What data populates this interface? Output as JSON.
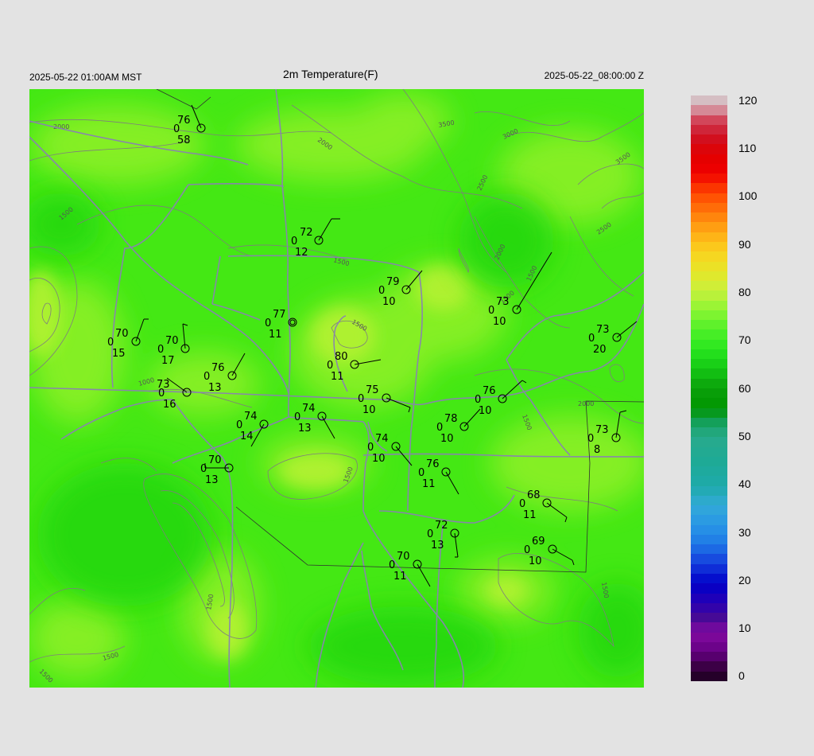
{
  "header": {
    "local_time": "2025-05-22 01:00AM MST",
    "title": "2m Temperature(F)",
    "utc_time": "2025-05-22_08:00:00 Z"
  },
  "colorbar": {
    "ticks": [
      "120",
      "110",
      "100",
      "90",
      "80",
      "70",
      "60",
      "50",
      "40",
      "30",
      "20",
      "10",
      "0"
    ]
  },
  "contour_labels": [
    "2000",
    "2000",
    "3500",
    "3000",
    "3500",
    "2500",
    "2500",
    "2000",
    "1500",
    "1500",
    "1500",
    "1000",
    "1500",
    "1500",
    "2000",
    "1500",
    "1500",
    "1500",
    "1500",
    "1500",
    "1500"
  ],
  "stations": [
    {
      "temp": "76",
      "dew": "0",
      "vis": "58"
    },
    {
      "temp": "72",
      "dew": "0",
      "vis": "12"
    },
    {
      "temp": "79",
      "dew": "0",
      "vis": "10"
    },
    {
      "temp": "73",
      "dew": "0",
      "vis": "10"
    },
    {
      "temp": "77",
      "dew": "0",
      "vis": "11"
    },
    {
      "temp": "70",
      "dew": "0",
      "vis": "15"
    },
    {
      "temp": "70",
      "dew": "0",
      "vis": "17"
    },
    {
      "temp": "80",
      "dew": "0",
      "vis": "11"
    },
    {
      "temp": "73",
      "dew": "0",
      "vis": "20"
    },
    {
      "temp": "76",
      "dew": "0",
      "vis": "13"
    },
    {
      "temp": "73",
      "dew": "0",
      "vis": "16"
    },
    {
      "temp": "75",
      "dew": "0",
      "vis": "10"
    },
    {
      "temp": "76",
      "dew": "0",
      "vis": "10"
    },
    {
      "temp": "74",
      "dew": "0",
      "vis": "13"
    },
    {
      "temp": "78",
      "dew": "0",
      "vis": "10"
    },
    {
      "temp": "74",
      "dew": "0",
      "vis": "14"
    },
    {
      "temp": "73",
      "dew": "0",
      "vis": "8"
    },
    {
      "temp": "74",
      "dew": "0",
      "vis": "10"
    },
    {
      "temp": "70",
      "dew": "0",
      "vis": "13"
    },
    {
      "temp": "76",
      "dew": "0",
      "vis": "11"
    },
    {
      "temp": "68",
      "dew": "0",
      "vis": "11"
    },
    {
      "temp": "72",
      "dew": "0",
      "vis": "13"
    },
    {
      "temp": "69",
      "dew": "0",
      "vis": "10"
    },
    {
      "temp": "70",
      "dew": "0",
      "vis": "11"
    }
  ]
}
